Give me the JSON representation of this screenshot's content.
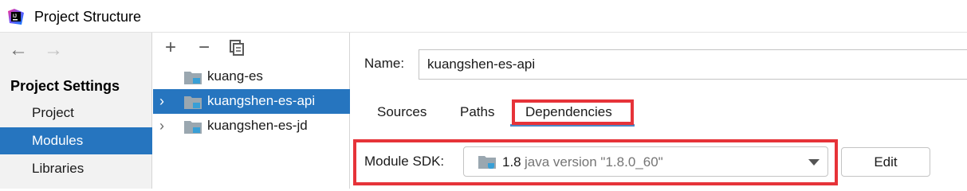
{
  "window": {
    "title": "Project Structure",
    "app_icon": "intellij-idea-icon"
  },
  "navigation": {
    "back_icon": "arrow-left-icon",
    "forward_icon": "arrow-right-icon",
    "back_glyph": "←",
    "forward_glyph": "→"
  },
  "sidebar": {
    "header": "Project Settings",
    "items": [
      {
        "label": "Project",
        "selected": false
      },
      {
        "label": "Modules",
        "selected": true
      },
      {
        "label": "Libraries",
        "selected": false
      }
    ]
  },
  "module_toolbar": {
    "add_glyph": "+",
    "remove_glyph": "−",
    "copy_icon": "copy-icon"
  },
  "module_tree": {
    "items": [
      {
        "label": "kuang-es",
        "expandable": false,
        "selected": false
      },
      {
        "label": "kuangshen-es-api",
        "expandable": true,
        "selected": true
      },
      {
        "label": "kuangshen-es-jd",
        "expandable": true,
        "selected": false
      }
    ],
    "chevron_glyph": "›"
  },
  "details": {
    "name_label": "Name:",
    "name_value": "kuangshen-es-api",
    "tabs": [
      {
        "label": "Sources",
        "active": false
      },
      {
        "label": "Paths",
        "active": false
      },
      {
        "label": "Dependencies",
        "active": true
      }
    ],
    "sdk_label": "Module SDK:",
    "sdk_version": "1.8",
    "sdk_detail": "java version \"1.8.0_60\"",
    "edit_label": "Edit"
  },
  "colors": {
    "selection": "#2675bf",
    "highlight_box": "#e63339",
    "tab_underline": "#4a88c7"
  }
}
